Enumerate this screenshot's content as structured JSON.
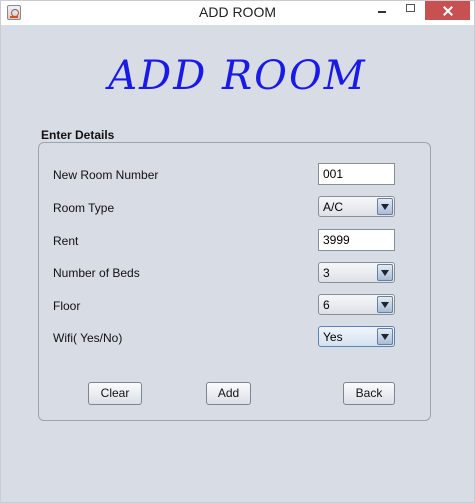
{
  "window": {
    "title": "ADD ROOM",
    "icon": "java-cup-icon"
  },
  "heading": "ADD ROOM",
  "panel": {
    "title": "Enter Details"
  },
  "form": {
    "room_number": {
      "label": "New Room Number",
      "value": "001"
    },
    "room_type": {
      "label": "Room Type",
      "value": "A/C"
    },
    "rent": {
      "label": "Rent",
      "value": "3999"
    },
    "beds": {
      "label": "Number of Beds",
      "value": "3"
    },
    "floor": {
      "label": "Floor",
      "value": "6"
    },
    "wifi": {
      "label": "Wifi( Yes/No)",
      "value": "Yes"
    }
  },
  "buttons": {
    "clear": "Clear",
    "add": "Add",
    "back": "Back"
  },
  "colors": {
    "heading": "#1a1ae6",
    "close_button": "#c75050",
    "background": "#d8dce4"
  }
}
